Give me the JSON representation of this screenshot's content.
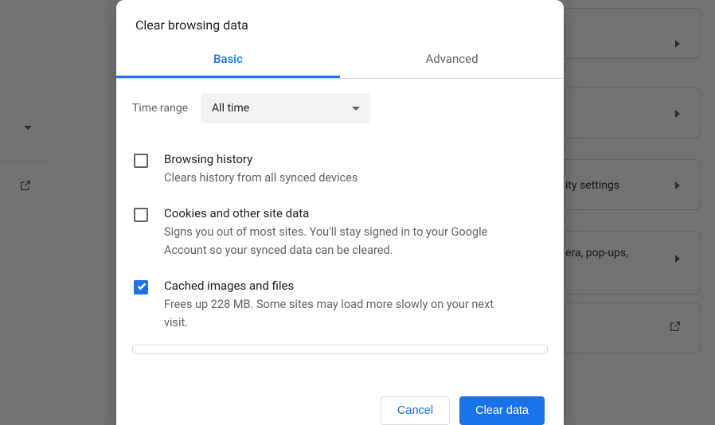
{
  "background": {
    "security_text": "ity settings",
    "popups_text": "era, pop-ups,"
  },
  "dialog": {
    "title": "Clear browsing data",
    "tabs": {
      "basic": "Basic",
      "advanced": "Advanced",
      "active": "basic"
    },
    "time_range": {
      "label": "Time range",
      "value": "All time"
    },
    "options": {
      "browsing_history": {
        "title": "Browsing history",
        "desc": "Clears history from all synced devices",
        "checked": false
      },
      "cookies": {
        "title": "Cookies and other site data",
        "desc": "Signs you out of most sites. You'll stay signed in to your Google Account so your synced data can be cleared.",
        "checked": false
      },
      "cache": {
        "title": "Cached images and files",
        "desc": "Frees up 228 MB. Some sites may load more slowly on your next visit.",
        "checked": true
      }
    },
    "footer": {
      "cancel": "Cancel",
      "clear": "Clear data"
    }
  }
}
